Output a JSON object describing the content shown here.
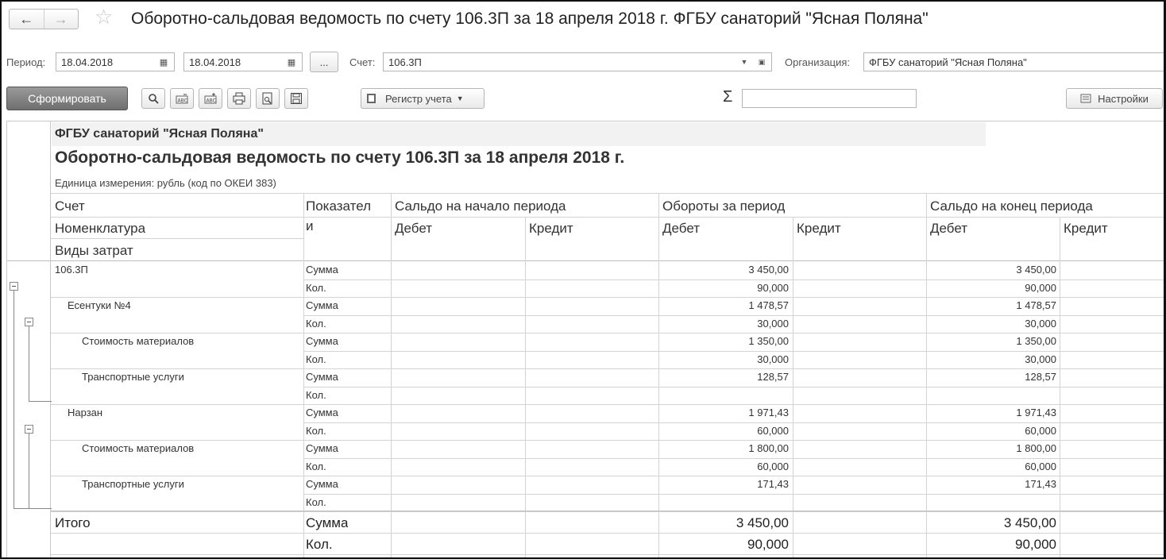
{
  "window": {
    "title": "Оборотно-сальдовая ведомость по счету 106.3П за 18 апреля 2018 г. ФГБУ санаторий \"Ясная Поляна\""
  },
  "filters": {
    "period_label": "Период:",
    "date_from": "18.04.2018",
    "date_to": "18.04.2018",
    "ellipsis_label": "...",
    "account_label": "Счет:",
    "account_value": "106.3П",
    "org_label": "Организация:",
    "org_value": "ФГБУ санаторий \"Ясная Поляна\""
  },
  "toolbar": {
    "generate_label": "Сформировать",
    "register_label": "Регистр учета",
    "settings_label": "Настройки",
    "sum_value": ""
  },
  "report": {
    "org_name": "ФГБУ санаторий \"Ясная Поляна\"",
    "title": "Оборотно-сальдовая ведомость по счету 106.3П за 18 апреля 2018 г.",
    "unit": "Единица измерения: рубль (код по ОКЕИ 383)",
    "headers": {
      "account": "Счет",
      "nomenclature": "Номенклатура",
      "cost_types": "Виды затрат",
      "indicator_1": "Показател",
      "indicator_2": "и",
      "opening": "Сальдо на начало периода",
      "turnover": "Обороты за период",
      "closing": "Сальдо на конец периода",
      "debit": "Дебет",
      "credit": "Кредит"
    },
    "rows": [
      {
        "name": "106.3П",
        "sum": "Сумма",
        "qty": "Кол.",
        "turn_debit_sum": "3 450,00",
        "turn_debit_qty": "90,000",
        "close_debit_sum": "3 450,00",
        "close_debit_qty": "90,000"
      },
      {
        "name": "Есентуки №4",
        "sum": "Сумма",
        "qty": "Кол.",
        "turn_debit_sum": "1 478,57",
        "turn_debit_qty": "30,000",
        "close_debit_sum": "1 478,57",
        "close_debit_qty": "30,000"
      },
      {
        "name": "Стоимость материалов",
        "sum": "Сумма",
        "qty": "Кол.",
        "turn_debit_sum": "1 350,00",
        "turn_debit_qty": "30,000",
        "close_debit_sum": "1 350,00",
        "close_debit_qty": "30,000"
      },
      {
        "name": "Транспортные услуги",
        "sum": "Сумма",
        "qty": "Кол.",
        "turn_debit_sum": "128,57",
        "turn_debit_qty": "",
        "close_debit_sum": "128,57",
        "close_debit_qty": ""
      },
      {
        "name": "Нарзан",
        "sum": "Сумма",
        "qty": "Кол.",
        "turn_debit_sum": "1 971,43",
        "turn_debit_qty": "60,000",
        "close_debit_sum": "1 971,43",
        "close_debit_qty": "60,000"
      },
      {
        "name": "Стоимость материалов",
        "sum": "Сумма",
        "qty": "Кол.",
        "turn_debit_sum": "1 800,00",
        "turn_debit_qty": "60,000",
        "close_debit_sum": "1 800,00",
        "close_debit_qty": "60,000"
      },
      {
        "name": "Транспортные услуги",
        "sum": "Сумма",
        "qty": "Кол.",
        "turn_debit_sum": "171,43",
        "turn_debit_qty": "",
        "close_debit_sum": "171,43",
        "close_debit_qty": ""
      }
    ],
    "total": {
      "name": "Итого",
      "sum": "Сумма",
      "qty": "Кол.",
      "turn_debit_sum": "3 450,00",
      "turn_debit_qty": "90,000",
      "close_debit_sum": "3 450,00",
      "close_debit_qty": "90,000"
    }
  }
}
